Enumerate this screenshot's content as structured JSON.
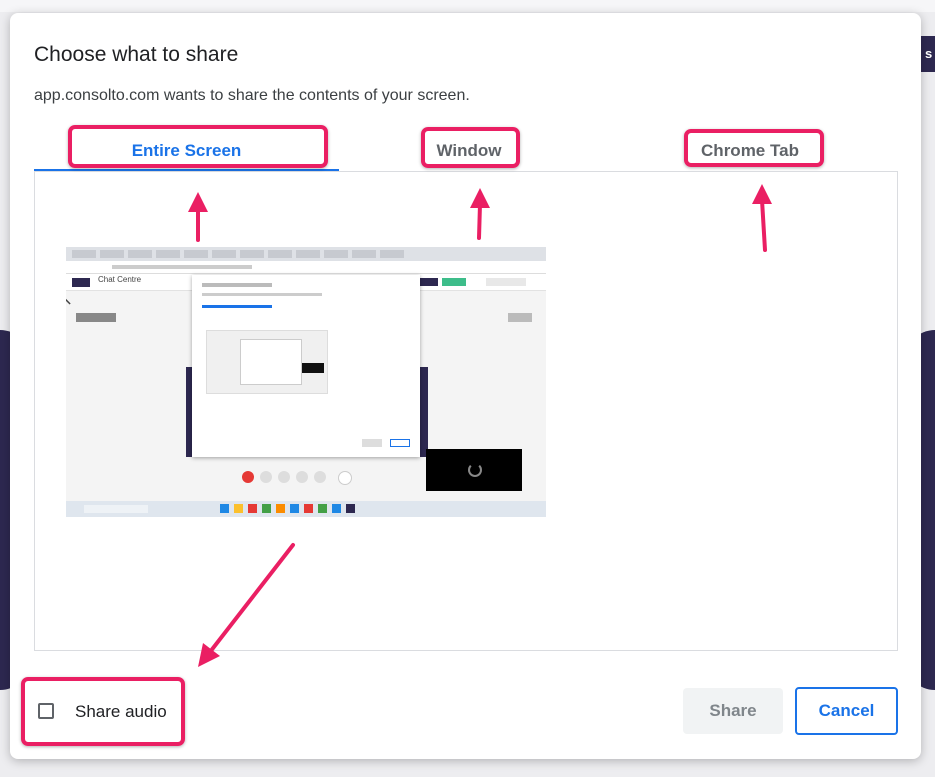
{
  "dialog": {
    "title": "Choose what to share",
    "subtitle": "app.consolto.com wants to share the contents of your screen.",
    "tabs": [
      {
        "label": "Entire Screen",
        "active": true
      },
      {
        "label": "Window",
        "active": false
      },
      {
        "label": "Chrome Tab",
        "active": false
      }
    ],
    "share_audio_label": "Share audio",
    "share_label": "Share",
    "cancel_label": "Cancel"
  },
  "thumbnail": {
    "brand": "Chat Centre"
  },
  "background": {
    "right_tab_text": "s"
  },
  "colors": {
    "accent": "#1a73e8",
    "annotation": "#ea1f63",
    "brand_purple": "#2d2850"
  },
  "icons": {
    "checkbox": "checkbox-unchecked-icon",
    "cursor": "mouse-cursor-icon"
  }
}
